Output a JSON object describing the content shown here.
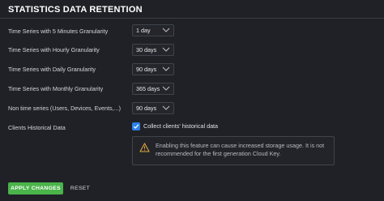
{
  "section": {
    "title": "STATISTICS DATA RETENTION"
  },
  "rows": [
    {
      "label": "Time Series with 5 Minutes Granularity",
      "value": "1 day"
    },
    {
      "label": "Time Series with Hourly Granularity",
      "value": "30 days"
    },
    {
      "label": "Time Series with Daily Granularity",
      "value": "90 days"
    },
    {
      "label": "Time Series with Monthly Granularity",
      "value": "365 days"
    },
    {
      "label": "Non time series (Users, Devices, Events,...)",
      "value": "90 days"
    }
  ],
  "historical": {
    "label": "Clients Historical Data",
    "checkbox_label": "Collect clients' historical data",
    "checked": true
  },
  "warning": {
    "icon": "warning-triangle-icon",
    "text": "Enabling this feature can cause increased storage usage. It is not recommended for the first generation Cloud Key."
  },
  "actions": {
    "apply_label": "APPLY CHANGES",
    "reset_label": "RESET"
  },
  "colors": {
    "accent_green": "#4ab34a",
    "checkbox_blue": "#2e80ea",
    "background": "#1f2126"
  }
}
